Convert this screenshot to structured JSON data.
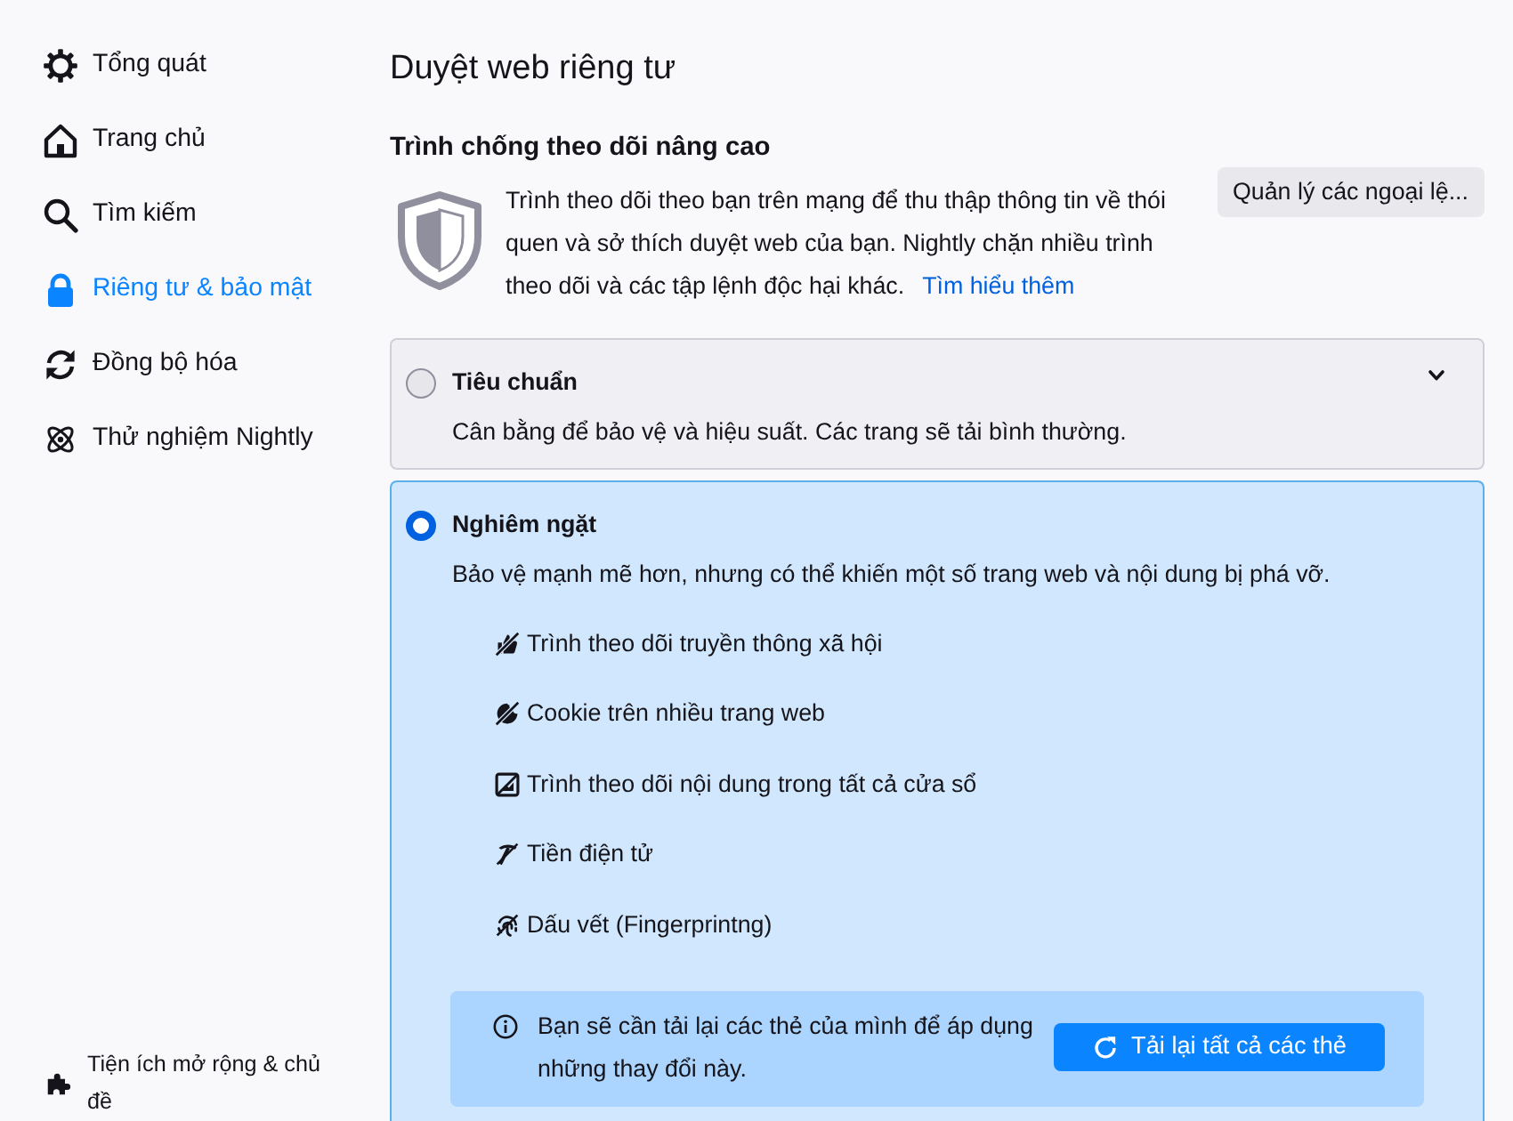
{
  "sidebar": {
    "items": [
      {
        "label": "Tổng quát",
        "selected": false
      },
      {
        "label": "Trang chủ",
        "selected": false
      },
      {
        "label": "Tìm kiếm",
        "selected": false
      },
      {
        "label": "Riêng tư & bảo mật",
        "selected": true
      },
      {
        "label": "Đồng bộ hóa",
        "selected": false
      },
      {
        "label": "Thử nghiệm Nightly",
        "selected": false
      }
    ],
    "footer_link": {
      "label": "Tiện ích mở rộng & chủ đề"
    }
  },
  "page": {
    "title": "Duyệt web riêng tư"
  },
  "tracking_protection": {
    "heading": "Trình chống theo dõi nâng cao",
    "description": "Trình theo dõi theo bạn trên mạng để thu thập thông tin về thói quen và sở thích duyệt web của bạn. Nightly chặn nhiều trình theo dõi và các tập lệnh độc hại khác.",
    "link": "Tìm hiểu thêm",
    "button": "Quản lý các ngoại lệ..."
  },
  "options": [
    {
      "title": "Tiêu chuẩn",
      "description": "Cân bằng để bảo vệ và hiệu suất. Các trang sẽ tải bình thường.",
      "selected": false
    },
    {
      "title": "Nghiêm ngặt",
      "description": "Bảo vệ mạnh mẽ hơn, nhưng có thể khiến một số trang web và nội dung bị phá vỡ.",
      "selected": true,
      "blocked_items": [
        "Trình theo dõi truyền thông xã hội",
        "Cookie trên nhiều trang web",
        "Trình theo dõi nội dung trong tất cả cửa sổ",
        "Tiền điện tử",
        "Dấu vết (Fingerprintng)"
      ],
      "notice": {
        "text": "Bạn sẽ cần tải lại các thẻ của mình để áp dụng những thay đổi này.",
        "button": "Tải lại tất cả các thẻ"
      }
    }
  ]
}
